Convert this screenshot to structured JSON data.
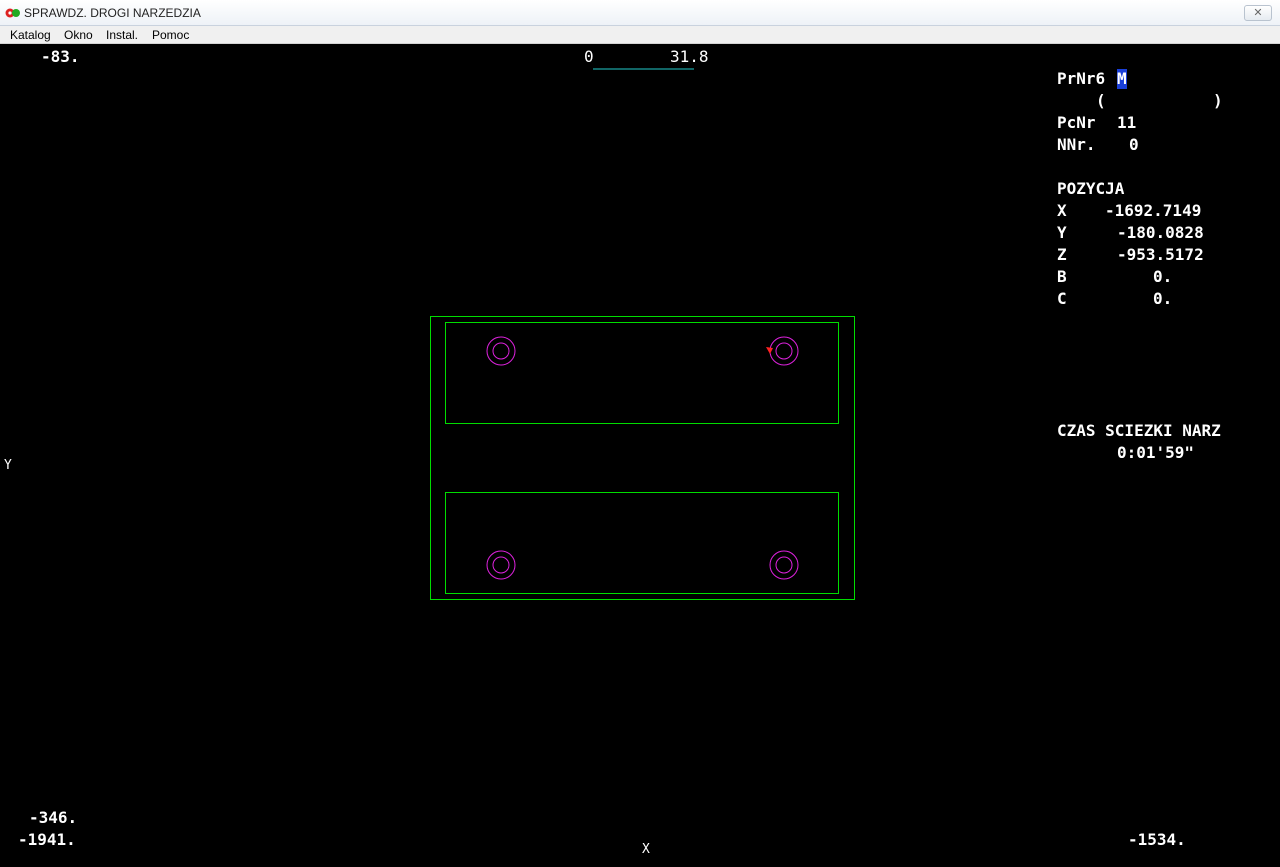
{
  "window": {
    "title": "SPRAWDZ. DROGI NARZEDZIA",
    "close_glyph": "✕"
  },
  "menu": {
    "items": [
      "Katalog",
      "Okno",
      "Instal.",
      "Pomoc"
    ]
  },
  "viewport": {
    "top_left_value": "-83.",
    "scale_start": "0",
    "scale_end": "31.8",
    "y_axis_label": "Y",
    "x_axis_label": "X",
    "bottom_left_upper": "-346.",
    "bottom_left_lower": "-1941.",
    "bottom_right": "-1534."
  },
  "info_panel": {
    "program_prefix": "PrNr6",
    "program_cursor": "M",
    "program_open": "(",
    "program_close": ")",
    "piece_label": "PcNr",
    "piece_value": "11",
    "n_label": "NNr.",
    "n_value": "0",
    "position_heading": "POZYCJA",
    "axes": [
      {
        "name": "X",
        "value": "-1692.7149"
      },
      {
        "name": "Y",
        "value": "-180.0828"
      },
      {
        "name": "Z",
        "value": "-953.5172"
      },
      {
        "name": "B",
        "value": "0."
      },
      {
        "name": "C",
        "value": "0."
      }
    ],
    "time_heading": "CZAS SCIEZKI NARZ",
    "time_value": "0:01'59\""
  },
  "colors": {
    "outline": "#00dd00",
    "holes": "#dd22dd",
    "scale_line": "#22cccc",
    "tool_marker": "#ff2222",
    "cursor_highlight": "#1a3fd8"
  }
}
